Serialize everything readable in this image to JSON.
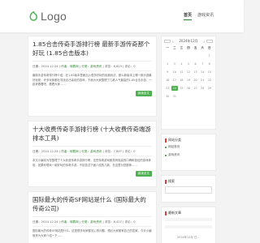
{
  "header": {
    "logo_text": "Logo",
    "nav": [
      {
        "label": "首页"
      },
      {
        "label": "游戏资讯"
      }
    ]
  },
  "posts": [
    {
      "title": "1.85合击传奇手游排行榜 最新手游传奇那个好玩 (1.85合击版本)",
      "date": "日期：2024-12-24",
      "author": "作者：转载网",
      "category": "分类：游戏资讯",
      "views": "浏览：6,823",
      "comments": "评论：0",
      "excerpt": "最新手游传奇排行榜介绍，在1.85版本里面加入很多好玩的经典玩法，那么新版本上哪一款手游最好玩呢，许多玩家都在寻找自己喜欢的游戏，下面为大家整理了几款人气最高的1.85合击手游，一起来看看吧，看看大家……",
      "more": "阅读全文"
    },
    {
      "title": "十大收费传奇手游排行榜 (十大收费传奇端游排本工具)",
      "date": "日期：2024-12-24",
      "author": "作者：转载网",
      "category": "分类：游戏资讯",
      "views": "浏览：7,897",
      "comments": "评论：0",
      "excerpt": "本文小编将为您整理了十大收费传奇手游排行榜，这些传奇游戏都具有极高的口碑和极佳的游戏体验，如果你想玩一款好玩的传奇手游，不妨尝试下面介绍的几款，在这里为您推荐……",
      "more": "阅读全文"
    },
    {
      "title": "国际最大的传奇SF网站是什么 (国际最大的传奇公司)",
      "date": "日期：2024-12-24",
      "author": "作者：转载网",
      "category": "分类：游戏资讯",
      "views": "浏览：8,427",
      "comments": "评论：0",
      "excerpt": "国际最大的传奇SF网站是什么，这是很多玩家都关心的问题，想必大家都有自己的答案，今天小编就来为大家介绍一下……",
      "more": "阅读全文"
    }
  ],
  "sidebar": {
    "calendar": {
      "prev": "‹",
      "month": "2024年12月",
      "next": "›",
      "weekdays": [
        "一",
        "二",
        "三",
        "四",
        "五",
        "六",
        "日"
      ],
      "days": [
        "",
        "",
        "",
        "",
        "",
        "",
        "1",
        "2",
        "3",
        "4",
        "5",
        "6",
        "7",
        "8",
        "9",
        "10",
        "11",
        "12",
        "13",
        "14",
        "15",
        "16",
        "17",
        "18",
        "19",
        "20",
        "21",
        "22",
        "23",
        "24",
        "25",
        "26",
        "27",
        "28",
        "29",
        "30",
        "31"
      ],
      "today": "24"
    },
    "links": {
      "title": "网站分类",
      "items": [
        "网站首页",
        "游戏资讯"
      ]
    },
    "search": {
      "title": "搜索"
    },
    "latest": {
      "title": "最新文章"
    },
    "footer": "2024年12月 日..."
  },
  "colors": {
    "accent": "#4caf50",
    "logo": "#4caf50",
    "widget_bar": "#e53935"
  }
}
